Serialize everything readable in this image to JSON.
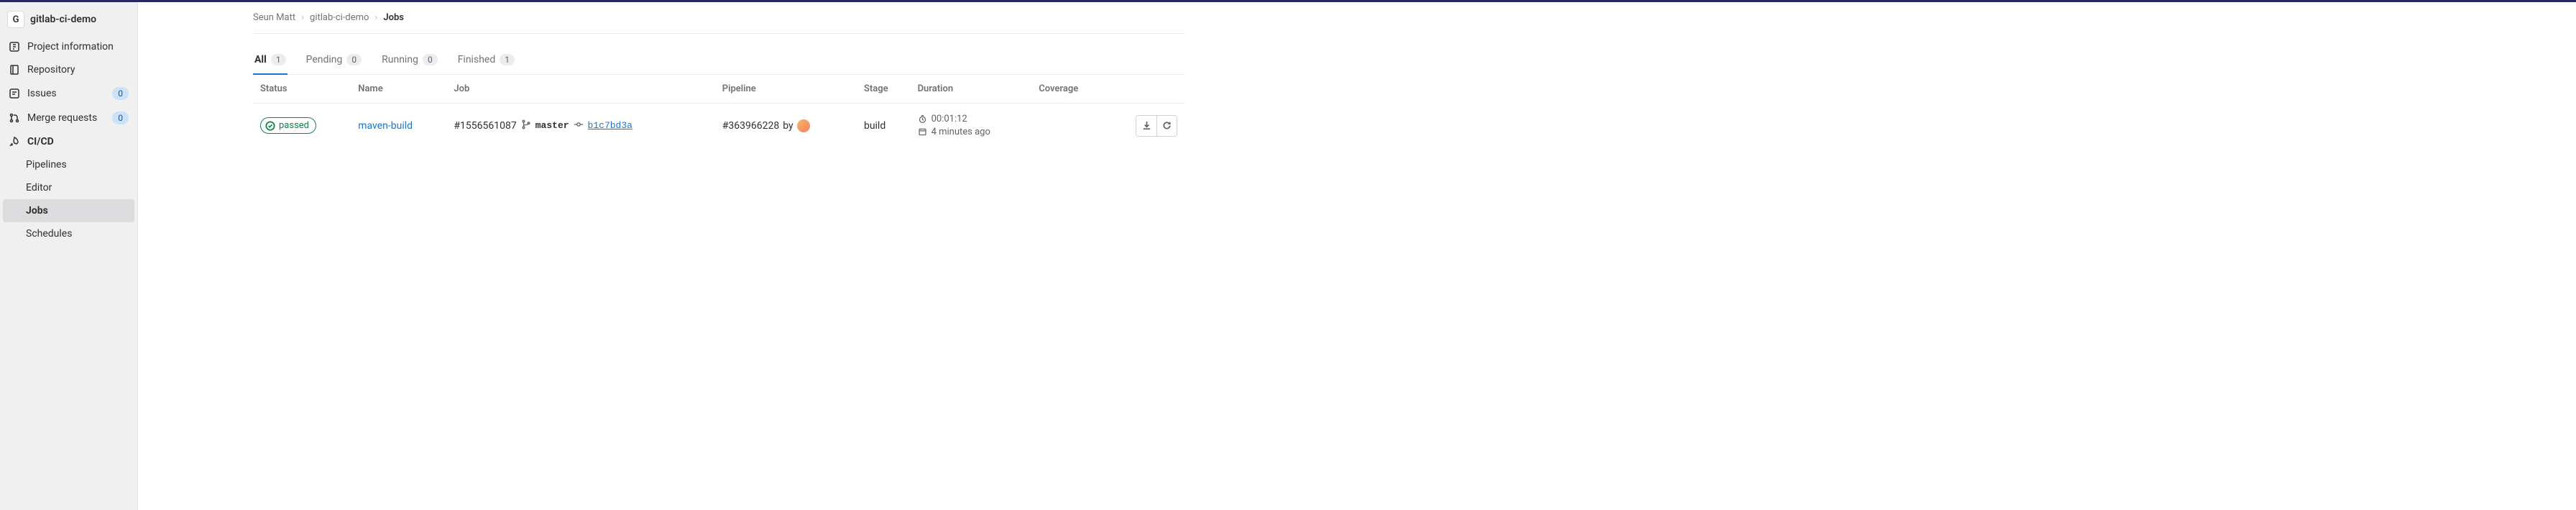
{
  "project": {
    "avatar_letter": "G",
    "name": "gitlab-ci-demo"
  },
  "sidebar": {
    "items": [
      {
        "label": "Project information",
        "icon": "info-icon"
      },
      {
        "label": "Repository",
        "icon": "repo-icon"
      },
      {
        "label": "Issues",
        "icon": "issues-icon",
        "badge": "0"
      },
      {
        "label": "Merge requests",
        "icon": "merge-icon",
        "badge": "0"
      },
      {
        "label": "CI/CD",
        "icon": "rocket-icon",
        "active": true
      }
    ],
    "cicd_sub": [
      {
        "label": "Pipelines"
      },
      {
        "label": "Editor"
      },
      {
        "label": "Jobs",
        "active": true
      },
      {
        "label": "Schedules"
      }
    ]
  },
  "breadcrumb": {
    "owner": "Seun Matt",
    "project": "gitlab-ci-demo",
    "page": "Jobs"
  },
  "tabs": [
    {
      "label": "All",
      "count": "1",
      "active": true
    },
    {
      "label": "Pending",
      "count": "0"
    },
    {
      "label": "Running",
      "count": "0"
    },
    {
      "label": "Finished",
      "count": "1"
    }
  ],
  "columns": {
    "status": "Status",
    "name": "Name",
    "job": "Job",
    "pipeline": "Pipeline",
    "stage": "Stage",
    "duration": "Duration",
    "coverage": "Coverage"
  },
  "job_row": {
    "status": "passed",
    "name": "maven-build",
    "job_id": "#1556561087",
    "branch": "master",
    "commit": "b1c7bd3a",
    "pipeline_id": "#363966228",
    "pipeline_by": "by",
    "stage": "build",
    "duration": "00:01:12",
    "finished": "4 minutes ago"
  }
}
